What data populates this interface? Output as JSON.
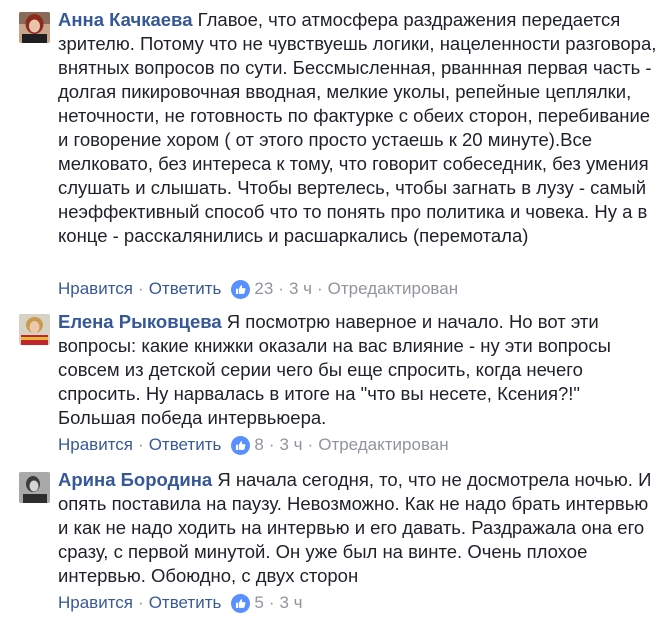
{
  "comments": [
    {
      "author": "Анна Качкаева",
      "text": "Главое, что атмосфера раздражения передается зрителю. Потому что не чувствуешь логики, нацеленности разговора, внятных вопросов по сути. Бессмысленная, рваннная первая часть - долгая пикировочная вводная, мелкие уколы, репейные цеплялки, неточности, не готовность по фактурке с обеих сторон, перебивание и говорение хором ( от этого просто устаешь к 20 минуте).Все мелковато, без интереса к тому, что говорит собеседник, без умения слушать и слышать. Чтобы вертелесь, чтобы загнать в лузу - самый неэффективный способ что то понять про политика и човека. Ну а в конце - расскалянились и расшаркались (перемотала)",
      "like_label": "Нравится",
      "reply_label": "Ответить",
      "reactions": "23",
      "time": "3 ч",
      "edited": "Отредактирован"
    },
    {
      "author": "Елена Рыковцева",
      "text": "Я посмотрю наверное и начало. Но вот эти вопросы: какие книжки оказали на вас влияние - ну эти вопросы совсем из детской серии чего бы еще спросить, когда нечего спросить. Ну нарвалась в итоге на \"что вы несете, Ксения?!\" Большая победа интервьюера.",
      "like_label": "Нравится",
      "reply_label": "Ответить",
      "reactions": "8",
      "time": "3 ч",
      "edited": "Отредактирован"
    },
    {
      "author": "Арина Бородина",
      "text": "Я начала сегодня, то, что не досмотрела ночью. И опять поставила на паузу. Невозможно. Как не надо брать интервью и как не надо ходить на интервью и его давать. Раздражала она его сразу, с первой минутой. Он уже был на винте. Очень плохое интервью. Обоюдно, с двух сторон",
      "like_label": "Нравится",
      "reply_label": "Ответить",
      "reactions": "5",
      "time": "3 ч"
    }
  ],
  "icons": {
    "like_reaction": "thumbs-up-icon",
    "dot_separator": "·"
  },
  "colors": {
    "author": "#365899",
    "link": "#385898",
    "muted": "#90949c",
    "text": "#1d2129",
    "like_badge": "#5890ff"
  }
}
